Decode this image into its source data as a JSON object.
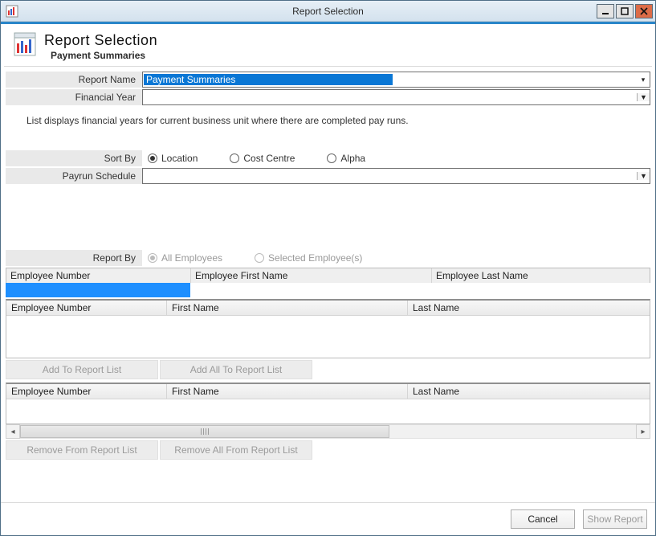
{
  "window": {
    "title": "Report Selection"
  },
  "header": {
    "title": "Report Selection",
    "subtitle": "Payment Summaries"
  },
  "form": {
    "report_name": {
      "label": "Report Name",
      "value": "Payment Summaries"
    },
    "financial_year": {
      "label": "Financial Year",
      "value": ""
    },
    "hint": "List displays financial years for current business unit where there are completed pay runs.",
    "sort_by": {
      "label": "Sort By",
      "options": [
        {
          "key": "location",
          "label": "Location",
          "checked": true
        },
        {
          "key": "cost_centre",
          "label": "Cost Centre",
          "checked": false
        },
        {
          "key": "alpha",
          "label": "Alpha",
          "checked": false
        }
      ]
    },
    "payrun_schedule": {
      "label": "Payrun Schedule",
      "value": ""
    },
    "report_by": {
      "label": "Report By",
      "options": [
        {
          "key": "all_employees",
          "label": "All Employees",
          "checked": true
        },
        {
          "key": "selected_employees",
          "label": "Selected Employee(s)",
          "checked": false
        }
      ],
      "disabled": true
    }
  },
  "filter_header": {
    "c1": "Employee Number",
    "c2": "Employee First Name",
    "c3": "Employee Last Name"
  },
  "grid_top": {
    "columns": {
      "c1": "Employee Number",
      "c2": "First Name",
      "c3": "Last Name"
    },
    "rows": []
  },
  "grid_bottom": {
    "columns": {
      "c1": "Employee Number",
      "c2": "First Name",
      "c3": "Last Name"
    },
    "rows": []
  },
  "buttons": {
    "add": "Add To Report List",
    "add_all": "Add All To Report List",
    "remove": "Remove From Report List",
    "remove_all": "Remove All From Report List",
    "cancel": "Cancel",
    "show_report": "Show Report"
  }
}
